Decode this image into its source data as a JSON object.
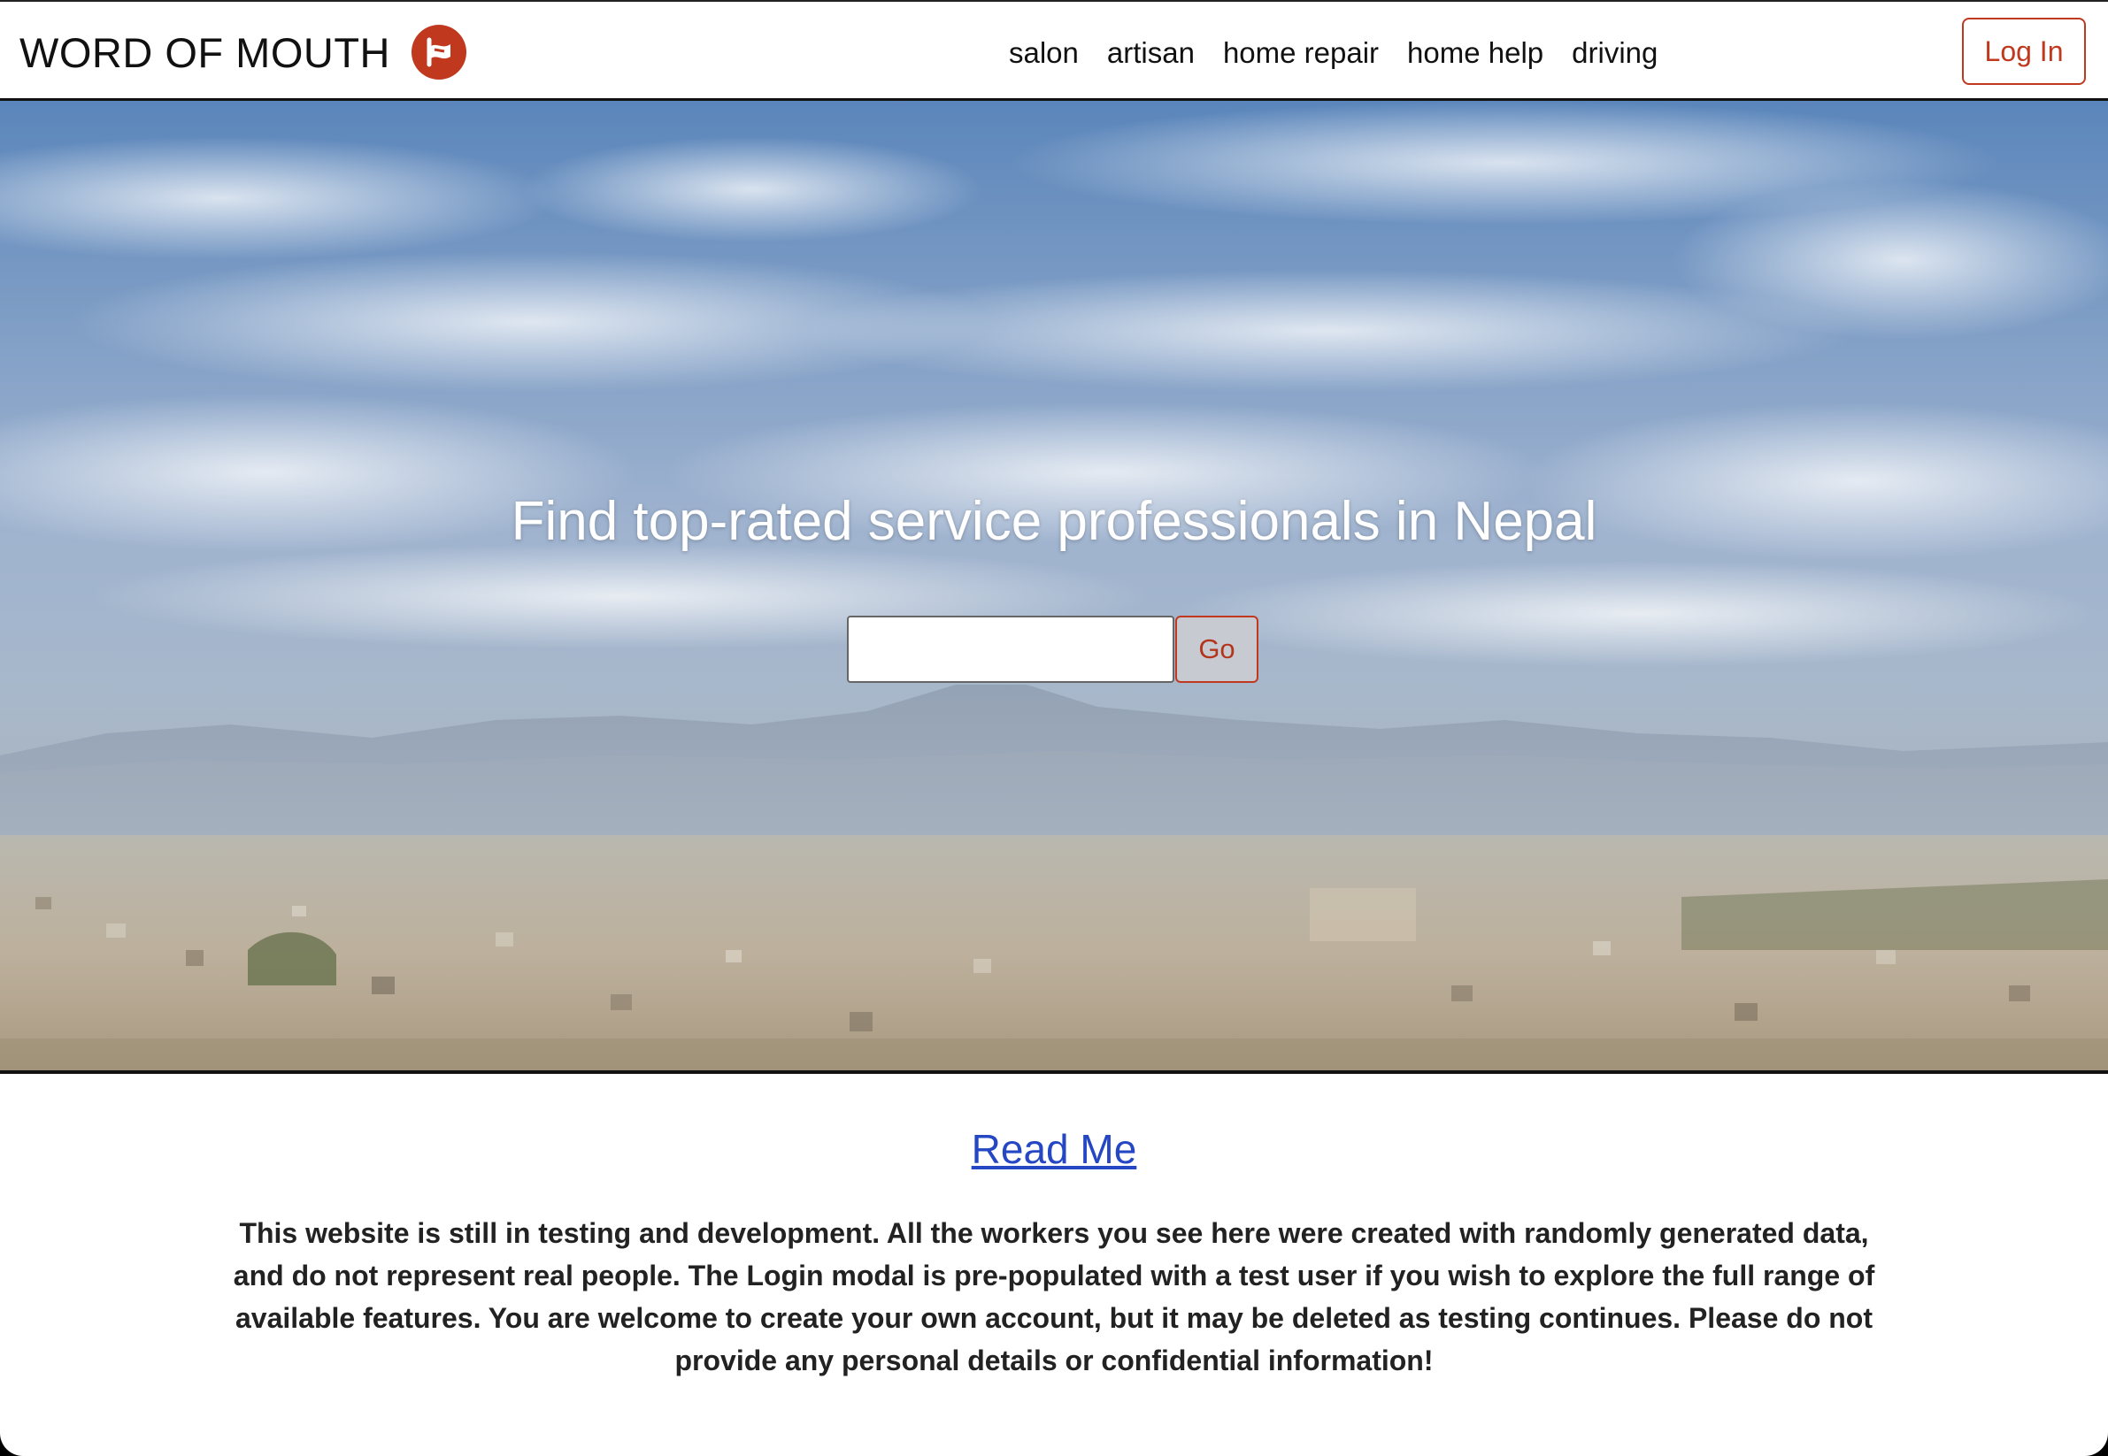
{
  "navbar": {
    "brand": "WORD OF MOUTH",
    "links": [
      "salon",
      "artisan",
      "home repair",
      "home help",
      "driving"
    ],
    "login_label": "Log In"
  },
  "hero": {
    "title": "Find top-rated service professionals in Nepal",
    "search_value": "",
    "go_label": "Go"
  },
  "readme": {
    "link_label": "Read Me",
    "text": "This website is still in testing and development. All the workers you see here were created with randomly generated data, and do not represent real people. The Login modal is pre-populated with a test user if you wish to explore the full range of available features. You are welcome to create your own account, but it may be deleted as testing continues. Please do not provide any personal details or confidential information!"
  },
  "colors": {
    "accent": "#c0391f",
    "link": "#2547c4",
    "text": "#222222"
  },
  "icons": {
    "brand_logo": "flag-logo-icon"
  }
}
